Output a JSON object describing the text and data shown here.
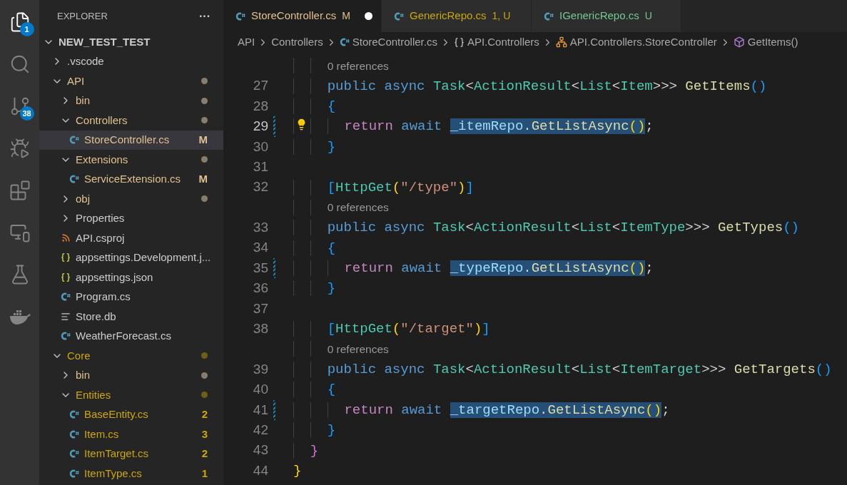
{
  "activity_bar": [
    {
      "kind": "explorer",
      "selected": true,
      "badge": "1"
    },
    {
      "kind": "search",
      "selected": false
    },
    {
      "kind": "source_control",
      "selected": false,
      "badge": "38"
    },
    {
      "kind": "run_debug",
      "selected": false
    },
    {
      "kind": "extensions",
      "selected": false
    },
    {
      "kind": "remote",
      "selected": false
    },
    {
      "kind": "testing",
      "selected": false
    },
    {
      "kind": "docker",
      "selected": false
    }
  ],
  "sidebar": {
    "title": "EXPLORER",
    "more": "···",
    "tree": [
      {
        "name": "NEW_TEST_TEST",
        "kind": "root",
        "expanded": true,
        "children": [
          {
            "name": ".vscode",
            "kind": "folder",
            "expanded": false,
            "color": "#cccccc"
          },
          {
            "name": "API",
            "kind": "folder",
            "expanded": true,
            "color": "#e2c08d",
            "decoration": {
              "kind": "dot",
              "color": "#8a7d6d"
            },
            "children": [
              {
                "name": "bin",
                "kind": "folder",
                "expanded": false,
                "color": "#e2c08d",
                "decoration": {
                  "kind": "dot",
                  "color": "#8a7d6d"
                }
              },
              {
                "name": "Controllers",
                "kind": "folder",
                "expanded": true,
                "color": "#e2c08d",
                "decoration": {
                  "kind": "dot",
                  "color": "#8a7d6d"
                },
                "children": [
                  {
                    "name": "StoreController.cs",
                    "kind": "csharp",
                    "color": "#e2c08d",
                    "selected": true,
                    "decoration": {
                      "kind": "text",
                      "text": "M",
                      "color": "#e2c08d"
                    }
                  }
                ]
              },
              {
                "name": "Extensions",
                "kind": "folder",
                "expanded": true,
                "color": "#e2c08d",
                "decoration": {
                  "kind": "dot",
                  "color": "#8a7d6d"
                },
                "children": [
                  {
                    "name": "ServiceExtension.cs",
                    "kind": "csharp",
                    "color": "#e2c08d",
                    "selected": false,
                    "decoration": {
                      "kind": "text",
                      "text": "M",
                      "color": "#e2c08d"
                    }
                  }
                ]
              },
              {
                "name": "obj",
                "kind": "folder",
                "expanded": false,
                "color": "#e2c08d",
                "decoration": {
                  "kind": "dot",
                  "color": "#8a7d6d"
                }
              },
              {
                "name": "Properties",
                "kind": "folder",
                "expanded": false,
                "color": "#cccccc"
              },
              {
                "name": "API.csproj",
                "kind": "rss",
                "color": "#cccccc",
                "selected": false
              },
              {
                "name": "appsettings.Development.j...",
                "kind": "json",
                "color": "#cccccc",
                "selected": false
              },
              {
                "name": "appsettings.json",
                "kind": "json",
                "color": "#cccccc",
                "selected": false
              },
              {
                "name": "Program.cs",
                "kind": "csharp",
                "color": "#cccccc",
                "selected": false
              },
              {
                "name": "Store.db",
                "kind": "lines",
                "color": "#cccccc",
                "selected": false
              },
              {
                "name": "WeatherForecast.cs",
                "kind": "csharp",
                "color": "#cccccc",
                "selected": false
              }
            ]
          },
          {
            "name": "Core",
            "kind": "folder",
            "expanded": true,
            "color": "#cca700",
            "decoration": {
              "kind": "dot",
              "color": "#6e5f16"
            },
            "children": [
              {
                "name": "bin",
                "kind": "folder",
                "expanded": false,
                "color": "#e2c08d",
                "decoration": {
                  "kind": "dot",
                  "color": "#8a7d6d"
                }
              },
              {
                "name": "Entities",
                "kind": "folder",
                "expanded": true,
                "color": "#cca700",
                "decoration": {
                  "kind": "dot",
                  "color": "#6e5f16"
                },
                "children": [
                  {
                    "name": "BaseEntity.cs",
                    "kind": "csharp",
                    "color": "#cca700",
                    "selected": false,
                    "decoration": {
                      "kind": "text",
                      "text": "2",
                      "color": "#cca700"
                    }
                  },
                  {
                    "name": "Item.cs",
                    "kind": "csharp",
                    "color": "#cca700",
                    "selected": false,
                    "decoration": {
                      "kind": "text",
                      "text": "3",
                      "color": "#cca700"
                    }
                  },
                  {
                    "name": "ItemTarget.cs",
                    "kind": "csharp",
                    "color": "#cca700",
                    "selected": false,
                    "decoration": {
                      "kind": "text",
                      "text": "2",
                      "color": "#cca700"
                    }
                  },
                  {
                    "name": "ItemType.cs",
                    "kind": "csharp",
                    "color": "#cca700",
                    "selected": false,
                    "decoration": {
                      "kind": "text",
                      "text": "1",
                      "color": "#cca700"
                    }
                  }
                ]
              }
            ]
          }
        ]
      }
    ]
  },
  "tabs": [
    {
      "label": "StoreController.cs",
      "selected": true,
      "color": "#e2c08d",
      "status": "M",
      "dirty": true
    },
    {
      "label": "GenericRepo.cs",
      "selected": false,
      "color": "#cca700",
      "status": "1, U",
      "dirty": false
    },
    {
      "label": "IGenericRepo.cs",
      "selected": false,
      "color": "#73c991",
      "status": "U",
      "dirty": false
    }
  ],
  "breadcrumb": [
    {
      "text": "API",
      "kind": "folder"
    },
    {
      "text": "Controllers",
      "kind": "folder"
    },
    {
      "text": "StoreController.cs",
      "kind": "csharp"
    },
    {
      "text": "API.Controllers",
      "kind": "namespace"
    },
    {
      "text": "API.Controllers.StoreController",
      "kind": "class"
    },
    {
      "text": "GetItems()",
      "kind": "method"
    }
  ],
  "editor": {
    "lines": [
      {
        "kind": "codelens",
        "text": "0 references"
      },
      {
        "kind": "code",
        "number": "27",
        "current": false,
        "modified": false,
        "lightbulb": false,
        "tokens": [
          {
            "text": "    public",
            "kind": "keyword"
          },
          {
            "text": " async ",
            "kind": "keyword"
          },
          {
            "text": "Task",
            "kind": "type"
          },
          {
            "text": "<",
            "kind": "plain"
          },
          {
            "text": "ActionResult",
            "kind": "type"
          },
          {
            "text": "<",
            "kind": "plain"
          },
          {
            "text": "List",
            "kind": "type"
          },
          {
            "text": "<",
            "kind": "plain"
          },
          {
            "text": "Item",
            "kind": "type"
          },
          {
            "text": ">>> ",
            "kind": "plain"
          },
          {
            "text": "GetItems",
            "kind": "function"
          },
          {
            "text": "()",
            "kind": "bracket3"
          }
        ]
      },
      {
        "kind": "code",
        "number": "28",
        "current": false,
        "modified": false,
        "lightbulb": false,
        "tokens": [
          {
            "text": "    {",
            "kind": "bracket3"
          }
        ]
      },
      {
        "kind": "code",
        "number": "29",
        "current": true,
        "modified": true,
        "lightbulb": true,
        "tokens": [
          {
            "text": "      return",
            "kind": "control"
          },
          {
            "text": " await ",
            "kind": "keyword"
          },
          {
            "text": "_itemRepo",
            "kind": "variable",
            "highlight": true
          },
          {
            "text": ".",
            "kind": "plain",
            "highlight": true
          },
          {
            "text": "GetListAsync",
            "kind": "function",
            "highlight": true
          },
          {
            "text": "()",
            "kind": "bracket1",
            "highlight": true
          },
          {
            "text": ";",
            "kind": "plain"
          }
        ]
      },
      {
        "kind": "code",
        "number": "30",
        "current": false,
        "modified": false,
        "lightbulb": false,
        "tokens": [
          {
            "text": "    }",
            "kind": "bracket3"
          }
        ]
      },
      {
        "kind": "code",
        "number": "31",
        "current": false,
        "modified": false,
        "lightbulb": false
      },
      {
        "kind": "code",
        "number": "32",
        "current": false,
        "modified": false,
        "lightbulb": false,
        "tokens": [
          {
            "text": "    [",
            "kind": "bracket3"
          },
          {
            "text": "HttpGet",
            "kind": "type"
          },
          {
            "text": "(",
            "kind": "bracket1"
          },
          {
            "text": "\"/type\"",
            "kind": "string"
          },
          {
            "text": ")",
            "kind": "bracket1"
          },
          {
            "text": "]",
            "kind": "bracket3"
          }
        ]
      },
      {
        "kind": "codelens",
        "text": "0 references"
      },
      {
        "kind": "code",
        "number": "33",
        "current": false,
        "modified": false,
        "lightbulb": false,
        "tokens": [
          {
            "text": "    public",
            "kind": "keyword"
          },
          {
            "text": " async ",
            "kind": "keyword"
          },
          {
            "text": "Task",
            "kind": "type"
          },
          {
            "text": "<",
            "kind": "plain"
          },
          {
            "text": "ActionResult",
            "kind": "type"
          },
          {
            "text": "<",
            "kind": "plain"
          },
          {
            "text": "List",
            "kind": "type"
          },
          {
            "text": "<",
            "kind": "plain"
          },
          {
            "text": "ItemType",
            "kind": "type"
          },
          {
            "text": ">>> ",
            "kind": "plain"
          },
          {
            "text": "GetTypes",
            "kind": "function"
          },
          {
            "text": "()",
            "kind": "bracket3"
          }
        ]
      },
      {
        "kind": "code",
        "number": "34",
        "current": false,
        "modified": false,
        "lightbulb": false,
        "tokens": [
          {
            "text": "    {",
            "kind": "bracket3"
          }
        ]
      },
      {
        "kind": "code",
        "number": "35",
        "current": false,
        "modified": true,
        "lightbulb": false,
        "tokens": [
          {
            "text": "      return",
            "kind": "control"
          },
          {
            "text": " await ",
            "kind": "keyword"
          },
          {
            "text": "_typeRepo",
            "kind": "variable",
            "highlight": true
          },
          {
            "text": ".",
            "kind": "plain",
            "highlight": true
          },
          {
            "text": "GetListAsync",
            "kind": "function",
            "highlight": true
          },
          {
            "text": "()",
            "kind": "bracket1",
            "highlight": true
          },
          {
            "text": ";",
            "kind": "plain"
          }
        ]
      },
      {
        "kind": "code",
        "number": "36",
        "current": false,
        "modified": false,
        "lightbulb": false,
        "tokens": [
          {
            "text": "    }",
            "kind": "bracket3"
          }
        ]
      },
      {
        "kind": "code",
        "number": "37",
        "current": false,
        "modified": false,
        "lightbulb": false
      },
      {
        "kind": "code",
        "number": "38",
        "current": false,
        "modified": false,
        "lightbulb": false,
        "tokens": [
          {
            "text": "    [",
            "kind": "bracket3"
          },
          {
            "text": "HttpGet",
            "kind": "type"
          },
          {
            "text": "(",
            "kind": "bracket1"
          },
          {
            "text": "\"/target\"",
            "kind": "string"
          },
          {
            "text": ")",
            "kind": "bracket1"
          },
          {
            "text": "]",
            "kind": "bracket3"
          }
        ]
      },
      {
        "kind": "codelens",
        "text": "0 references"
      },
      {
        "kind": "code",
        "number": "39",
        "current": false,
        "modified": false,
        "lightbulb": false,
        "tokens": [
          {
            "text": "    public",
            "kind": "keyword"
          },
          {
            "text": " async ",
            "kind": "keyword"
          },
          {
            "text": "Task",
            "kind": "type"
          },
          {
            "text": "<",
            "kind": "plain"
          },
          {
            "text": "ActionResult",
            "kind": "type"
          },
          {
            "text": "<",
            "kind": "plain"
          },
          {
            "text": "List",
            "kind": "type"
          },
          {
            "text": "<",
            "kind": "plain"
          },
          {
            "text": "ItemTarget",
            "kind": "type"
          },
          {
            "text": ">>> ",
            "kind": "plain"
          },
          {
            "text": "GetTargets",
            "kind": "function"
          },
          {
            "text": "()",
            "kind": "bracket3"
          }
        ]
      },
      {
        "kind": "code",
        "number": "40",
        "current": false,
        "modified": false,
        "lightbulb": false,
        "tokens": [
          {
            "text": "    {",
            "kind": "bracket3"
          }
        ]
      },
      {
        "kind": "code",
        "number": "41",
        "current": false,
        "modified": true,
        "lightbulb": false,
        "tokens": [
          {
            "text": "      return",
            "kind": "control"
          },
          {
            "text": " await ",
            "kind": "keyword"
          },
          {
            "text": "_targetRepo",
            "kind": "variable",
            "highlight": true
          },
          {
            "text": ".",
            "kind": "plain",
            "highlight": true
          },
          {
            "text": "GetListAsync",
            "kind": "function",
            "highlight": true
          },
          {
            "text": "()",
            "kind": "bracket1",
            "highlight": true
          },
          {
            "text": ";",
            "kind": "plain"
          }
        ]
      },
      {
        "kind": "code",
        "number": "42",
        "current": false,
        "modified": false,
        "lightbulb": false,
        "tokens": [
          {
            "text": "    }",
            "kind": "bracket3"
          }
        ]
      },
      {
        "kind": "code",
        "number": "43",
        "current": false,
        "modified": false,
        "lightbulb": false,
        "tokens": [
          {
            "text": "  }",
            "kind": "bracket2"
          }
        ]
      },
      {
        "kind": "code",
        "number": "44",
        "current": false,
        "modified": false,
        "lightbulb": false,
        "tokens": [
          {
            "text": "}",
            "kind": "bracket1"
          }
        ]
      }
    ]
  }
}
